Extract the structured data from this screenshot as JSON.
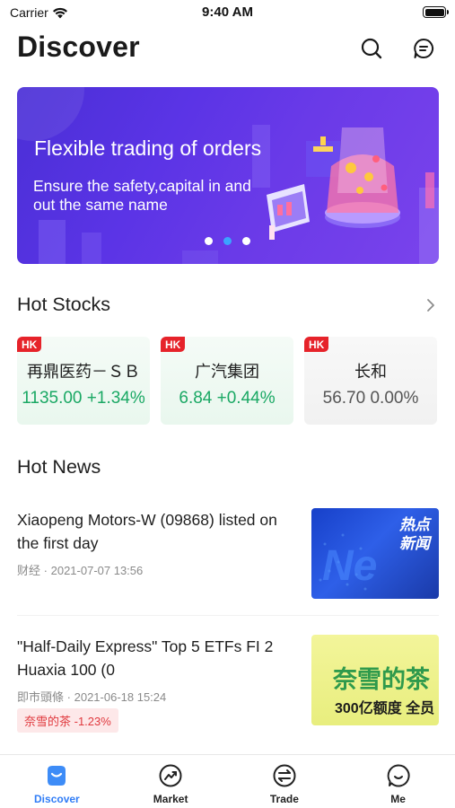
{
  "status_bar": {
    "carrier": "Carrier",
    "time": "9:40 AM"
  },
  "header": {
    "title": "Discover"
  },
  "icons": {
    "search": "search-icon",
    "message": "message-icon"
  },
  "banner": {
    "title": "Flexible trading of orders",
    "subtitle": "Ensure the safety,capital in and out the same name",
    "slides": 3,
    "active_slide": 2
  },
  "hot_stocks": {
    "title": "Hot Stocks",
    "items": [
      {
        "market": "HK",
        "name": "再鼎医药－ＳＢ",
        "price": "1135.00",
        "change": "+1.34%",
        "trend": "up"
      },
      {
        "market": "HK",
        "name": "广汽集团",
        "price": "6.84",
        "change": "+0.44%",
        "trend": "up"
      },
      {
        "market": "HK",
        "name": "长和",
        "price": "56.70",
        "change": "0.00%",
        "trend": "flat"
      }
    ]
  },
  "hot_news": {
    "title": "Hot News",
    "items": [
      {
        "title": "Xiaopeng Motors-W (09868) listed on the first day",
        "source": "财经",
        "time": "2021-07-07 13:56",
        "thumb_text_1": "热点",
        "thumb_text_2": "新闻"
      },
      {
        "title": "\"Half-Daily Express\" Top 5 ETFs FI 2 Huaxia 100 (0",
        "source": "即市頭條",
        "time": "2021-06-18 15:24",
        "tag": "奈雪的茶  -1.23%",
        "thumb_text_1": "奈雪的茶",
        "thumb_text_2": "300亿额度 全员"
      }
    ]
  },
  "tab_bar": {
    "tabs": [
      {
        "label": "Discover",
        "active": true
      },
      {
        "label": "Market",
        "active": false
      },
      {
        "label": "Trade",
        "active": false
      },
      {
        "label": "Me",
        "active": false
      }
    ]
  },
  "colors": {
    "accent": "#2f7cf6",
    "up": "#1aa864",
    "down_tag": "#e0393e",
    "hk_tag": "#e6232a",
    "banner": "#5b34e6"
  }
}
